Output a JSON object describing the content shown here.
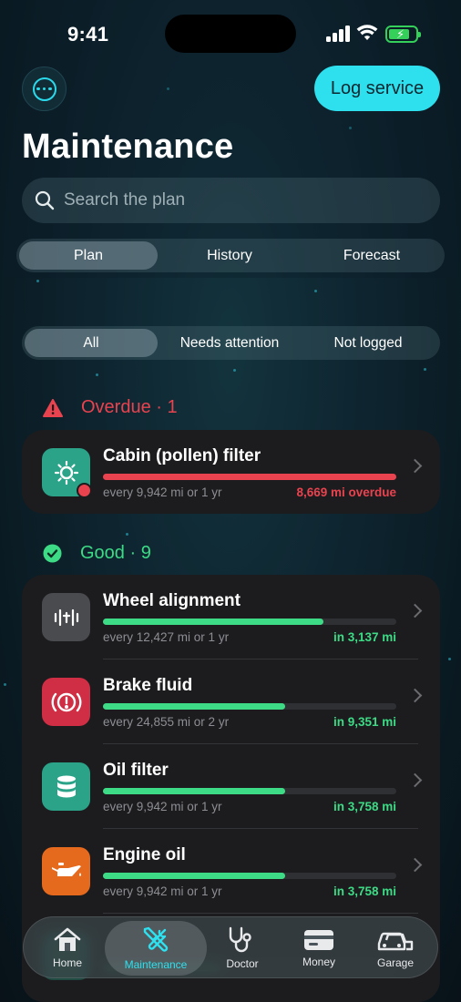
{
  "status_bar": {
    "time": "9:41"
  },
  "header": {
    "title": "Maintenance",
    "log_button": "Log service",
    "search_placeholder": "Search the plan"
  },
  "view_tabs": [
    "Plan",
    "History",
    "Forecast"
  ],
  "active_view_tab": "Plan",
  "filters": [
    "All",
    "Needs attention",
    "Not logged"
  ],
  "active_filter": "All",
  "sections": {
    "overdue": {
      "label": "Overdue · 1",
      "color": "#e8434f",
      "items": [
        {
          "name": "Cabin (pollen) filter",
          "interval": "every 9,942 mi or 1 yr",
          "status": "8,669 mi overdue",
          "progress": 1.0,
          "icon": "fan-icon",
          "icon_bg": "#2aa389"
        }
      ]
    },
    "good": {
      "label": "Good · 9",
      "color": "#3ddb86",
      "items": [
        {
          "name": "Wheel alignment",
          "interval": "every 12,427 mi or 1 yr",
          "status": "in 3,137 mi",
          "progress": 0.75,
          "icon": "alignment-icon",
          "icon_bg": "#4a4b4f"
        },
        {
          "name": "Brake fluid",
          "interval": "every 24,855 mi or 2 yr",
          "status": "in 9,351 mi",
          "progress": 0.62,
          "icon": "brake-warning-icon",
          "icon_bg": "#cf2e44"
        },
        {
          "name": "Oil filter",
          "interval": "every 9,942 mi or 1 yr",
          "status": "in 3,758 mi",
          "progress": 0.62,
          "icon": "oil-filter-icon",
          "icon_bg": "#2aa389"
        },
        {
          "name": "Engine oil",
          "interval": "every 9,942 mi or 1 yr",
          "status": "in 3,758 mi",
          "progress": 0.62,
          "icon": "oil-can-icon",
          "icon_bg": "#e66a1e"
        }
      ]
    }
  },
  "tab_bar": {
    "items": [
      "Home",
      "Maintenance",
      "Doctor",
      "Money",
      "Garage"
    ],
    "active": "Maintenance"
  },
  "colors": {
    "accent": "#2ee0ee",
    "danger": "#e8434f",
    "good": "#3ddb86"
  }
}
